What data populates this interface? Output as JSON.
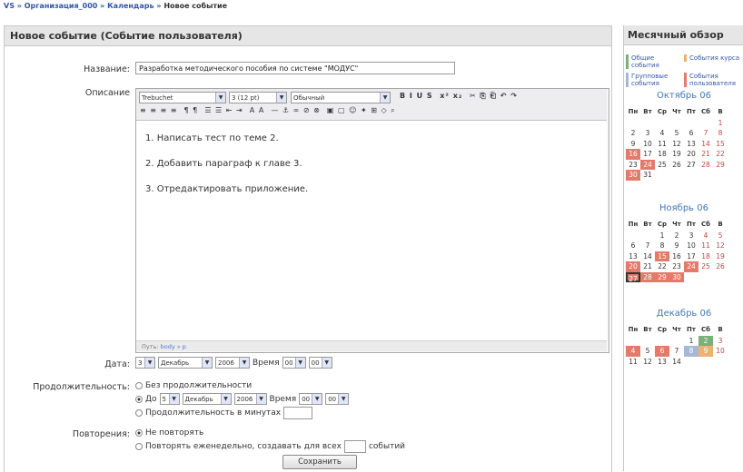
{
  "breadcrumb": {
    "a": "VS",
    "sep": "»",
    "b": "Организация_000",
    "c": "Календарь",
    "d": "Новое событие"
  },
  "form": {
    "title": "Новое событие (Событие пользователя)",
    "name_label": "Название:",
    "name_value": "Разработка методического пособия по системе \"МОДУС\"",
    "desc_label": "Описание",
    "font": "Trebuchet",
    "size": "3 (12 pt)",
    "style": "Обычный",
    "lines": [
      "1. Написать тест по теме 2.",
      "2. Добавить параграф к главе 3.",
      "3. Отредактировать приложение."
    ],
    "path": "Путь:",
    "path_val": "body » p",
    "date_label": "Дата:",
    "day": "3",
    "month": "Декабрь",
    "year": "2006",
    "time_label": "Время",
    "hh": "00",
    "mm": "00",
    "dur_label": "Продолжительность:",
    "dur_none": "Без продолжительности",
    "dur_until": "До",
    "u_day": "5",
    "u_month": "Декабрь",
    "u_year": "2006",
    "u_time_label": "Время",
    "u_hh": "00",
    "u_mm": "00",
    "dur_min": "Продолжительность в минутах",
    "rep_label": "Повторения:",
    "rep_no": "Не повторять",
    "rep_weekly": "Повторять еженедельно, создавать для всех",
    "rep_suffix": "событий",
    "save": "Сохранить"
  },
  "sidebar": {
    "title": "Месячный обзор",
    "legend": {
      "general": "Общие события",
      "course": "События курса",
      "group": "Групповые события",
      "user": "События пользователя"
    },
    "weekdays": [
      "Пн",
      "Вт",
      "Ср",
      "Чт",
      "Пт",
      "Сб",
      "В"
    ],
    "oct": {
      "name": "Октябрь 06"
    },
    "nov": {
      "name": "Ноябрь 06"
    },
    "dec": {
      "name": "Декабрь 06"
    }
  }
}
